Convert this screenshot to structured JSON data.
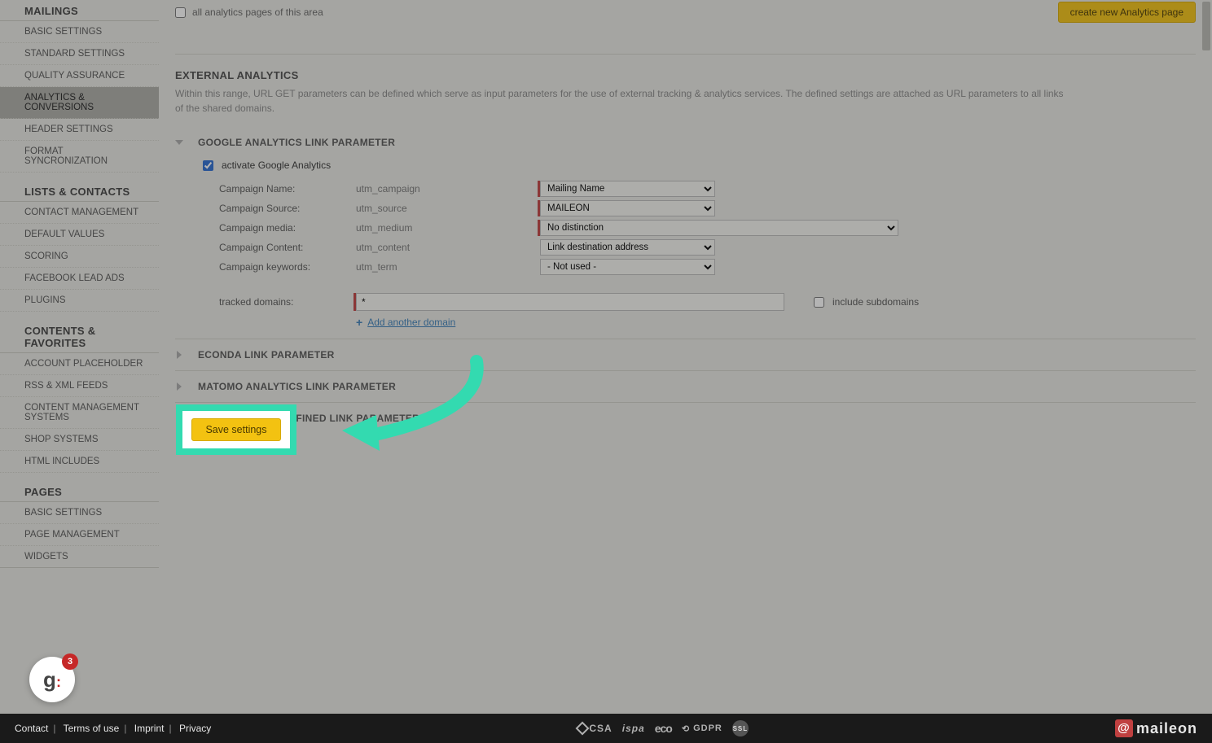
{
  "sidebar": {
    "sections": [
      {
        "header": "MAILINGS",
        "items": [
          {
            "label": "BASIC SETTINGS"
          },
          {
            "label": "STANDARD SETTINGS"
          },
          {
            "label": "QUALITY ASSURANCE"
          },
          {
            "label": "ANALYTICS & CONVERSIONS",
            "active": true
          },
          {
            "label": "HEADER SETTINGS"
          },
          {
            "label": "FORMAT SYNCRONIZATION"
          }
        ]
      },
      {
        "header": "LISTS & CONTACTS",
        "items": [
          {
            "label": "CONTACT MANAGEMENT"
          },
          {
            "label": "DEFAULT VALUES"
          },
          {
            "label": "SCORING"
          },
          {
            "label": "FACEBOOK LEAD ADS"
          },
          {
            "label": "PLUGINS"
          }
        ]
      },
      {
        "header": "CONTENTS & FAVORITES",
        "items": [
          {
            "label": "ACCOUNT PLACEHOLDER"
          },
          {
            "label": "RSS & XML FEEDS"
          },
          {
            "label": "CONTENT MANAGEMENT SYSTEMS"
          },
          {
            "label": "SHOP SYSTEMS"
          },
          {
            "label": "HTML INCLUDES"
          }
        ]
      },
      {
        "header": "PAGES",
        "items": [
          {
            "label": "BASIC SETTINGS"
          },
          {
            "label": "PAGE MANAGEMENT"
          },
          {
            "label": "WIDGETS"
          }
        ]
      }
    ]
  },
  "top": {
    "checkbox_label": "all analytics pages of this area",
    "create_button": "create new Analytics page"
  },
  "external_analytics": {
    "title": "EXTERNAL ANALYTICS",
    "desc": "Within this range, URL GET parameters can be defined which serve as input parameters for the use of external tracking & analytics services. The defined settings are attached as URL parameters to all links of the shared domains."
  },
  "ga": {
    "header": "GOOGLE ANALYTICS LINK PARAMETER",
    "activate_label": "activate Google Analytics",
    "activate_checked": true,
    "params": [
      {
        "label": "Campaign Name:",
        "key": "utm_campaign",
        "select": "Mailing Name",
        "red": true,
        "wide": false
      },
      {
        "label": "Campaign Source:",
        "key": "utm_source",
        "select": "MAILEON",
        "red": true,
        "wide": false
      },
      {
        "label": "Campaign media:",
        "key": "utm_medium",
        "select": "No distinction",
        "red": true,
        "wide": true
      },
      {
        "label": "Campaign Content:",
        "key": "utm_content",
        "select": "Link destination address",
        "red": false,
        "wide": false
      },
      {
        "label": "Campaign keywords:",
        "key": "utm_term",
        "select": "- Not used -",
        "red": false,
        "wide": false
      }
    ],
    "tracked_label": "tracked domains:",
    "tracked_value": "*",
    "include_sub_label": "include subdomains",
    "add_domain_label": "Add another domain"
  },
  "collapsed_sections": [
    {
      "header": "ECONDA LINK PARAMETER"
    },
    {
      "header": "MATOMO ANALYTICS LINK PARAMETER"
    },
    {
      "header": "ACTIVATE USER-DEFINED LINK PARAMETER"
    }
  ],
  "save_button": "Save settings",
  "footer": {
    "links": [
      "Contact",
      "Terms of use",
      "Imprint",
      "Privacy"
    ],
    "center": [
      "CSA",
      "ispa",
      "eco",
      "GDPR",
      "SSL"
    ],
    "brand": "maileon"
  },
  "help_badge_count": "3"
}
